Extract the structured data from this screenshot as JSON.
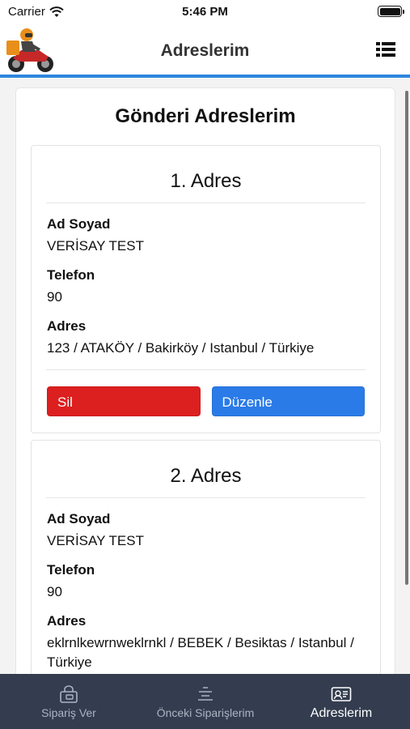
{
  "status_bar": {
    "carrier": "Carrier",
    "time": "5:46 PM",
    "icons": [
      "wifi-icon",
      "battery-icon"
    ]
  },
  "header": {
    "title": "Adreslerim",
    "logo": "motorcycle-courier-logo",
    "menu_icon": "list-menu-icon",
    "accent": "#2e86de"
  },
  "page": {
    "title": "Gönderi Adreslerim"
  },
  "labels": {
    "name": "Ad Soyad",
    "phone": "Telefon",
    "address": "Adres"
  },
  "addresses": [
    {
      "title": "1. Adres",
      "name": "VERİSAY TEST",
      "phone": "90",
      "address": "123 / ATAKÖY / Bakirköy / Istanbul / Türkiye",
      "delete_label": "Sil",
      "edit_label": "Düzenle"
    },
    {
      "title": "2. Adres",
      "name": "VERİSAY TEST",
      "phone": "90",
      "address": "eklrnlkewrnweklrnkl / BEBEK / Besiktas / Istanbul / Türkiye"
    }
  ],
  "colors": {
    "delete": "#dc1f1f",
    "edit": "#2a7be8",
    "tabbar": "#333d4f"
  },
  "tabs": [
    {
      "label": "Sipariş Ver",
      "icon": "shopping-bag-icon",
      "active": false
    },
    {
      "label": "Önceki Siparişlerim",
      "icon": "list-lines-icon",
      "active": false
    },
    {
      "label": "Adreslerim",
      "icon": "address-card-icon",
      "active": true
    }
  ]
}
